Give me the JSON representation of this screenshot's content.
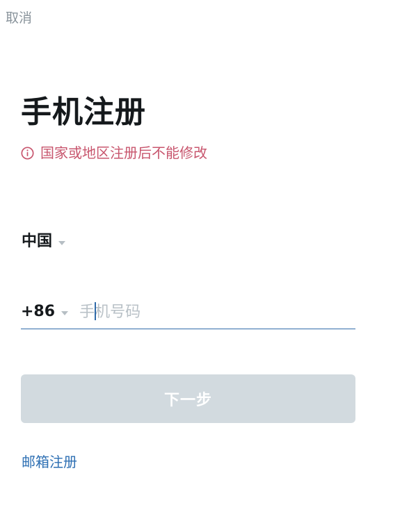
{
  "header": {
    "cancel_label": "取消"
  },
  "main": {
    "title": "手机注册",
    "notice": {
      "icon": "info-circle-icon",
      "text": "国家或地区注册后不能修改",
      "color": "#c8566e"
    },
    "country": {
      "value": "中国",
      "icon": "caret-down-icon"
    },
    "phone": {
      "country_code": "+86",
      "value": "",
      "placeholder": "手机号码"
    },
    "next_button_label": "下一步",
    "email_register_link": "邮箱注册"
  },
  "colors": {
    "accent": "#2f6aa9",
    "link": "#2d6fb3",
    "warning": "#c8566e",
    "button_disabled": "#d2dadf"
  }
}
